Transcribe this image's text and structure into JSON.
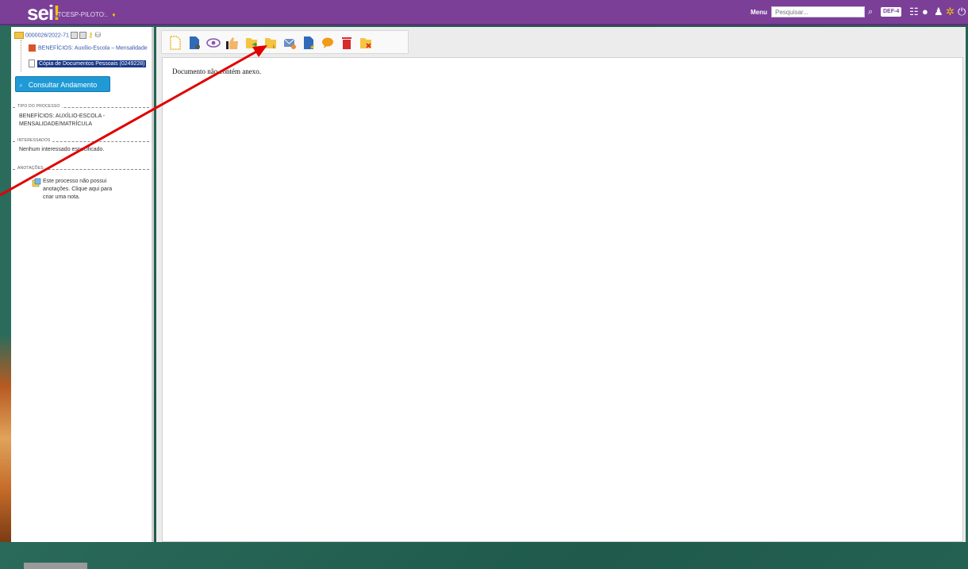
{
  "header": {
    "logo_text": "sei",
    "logo_dot": "!",
    "org_text": ".:TCESP-PILOTO:.",
    "menu_label": "Menu",
    "search_placeholder": "Pesquisar...",
    "unit_badge": "DEF-4",
    "bg_color": "#7b3f98",
    "icons": [
      "search-icon",
      "grid-icon",
      "info-icon",
      "user-icon",
      "settings-icon",
      "power-icon"
    ]
  },
  "tree": {
    "process_number": "0000026/2022-71",
    "item_process": "BENEFÍCIOS: Auxílio-Escola – Mensalidade",
    "item_document": "Cópia de Documentos Pessoais (0249228)"
  },
  "left": {
    "consult_button": "Consultar Andamento",
    "tipo_legend": "TIPO DO PROCESSO",
    "tipo_value": "BENEFÍCIOS: AUXÍLIO-ESCOLA - MENSALIDADE/MATRÍCULA",
    "interessados_legend": "INTERESSADOS",
    "interessados_value": "Nenhum interessado especificado.",
    "anotacoes_legend": "ANOTAÇÕES",
    "anotacoes_value": "Este processo não possui anotações. Clique aqui para criar uma nota."
  },
  "toolbar": {
    "icons": [
      "new-document-icon",
      "document-settings-icon",
      "view-icon",
      "like-icon",
      "move-document-icon",
      "document-info-icon",
      "send-email-icon",
      "favorite-document-icon",
      "comment-icon",
      "delete-icon",
      "cancel-document-icon"
    ]
  },
  "content": {
    "message": "Documento não contém anexo."
  }
}
